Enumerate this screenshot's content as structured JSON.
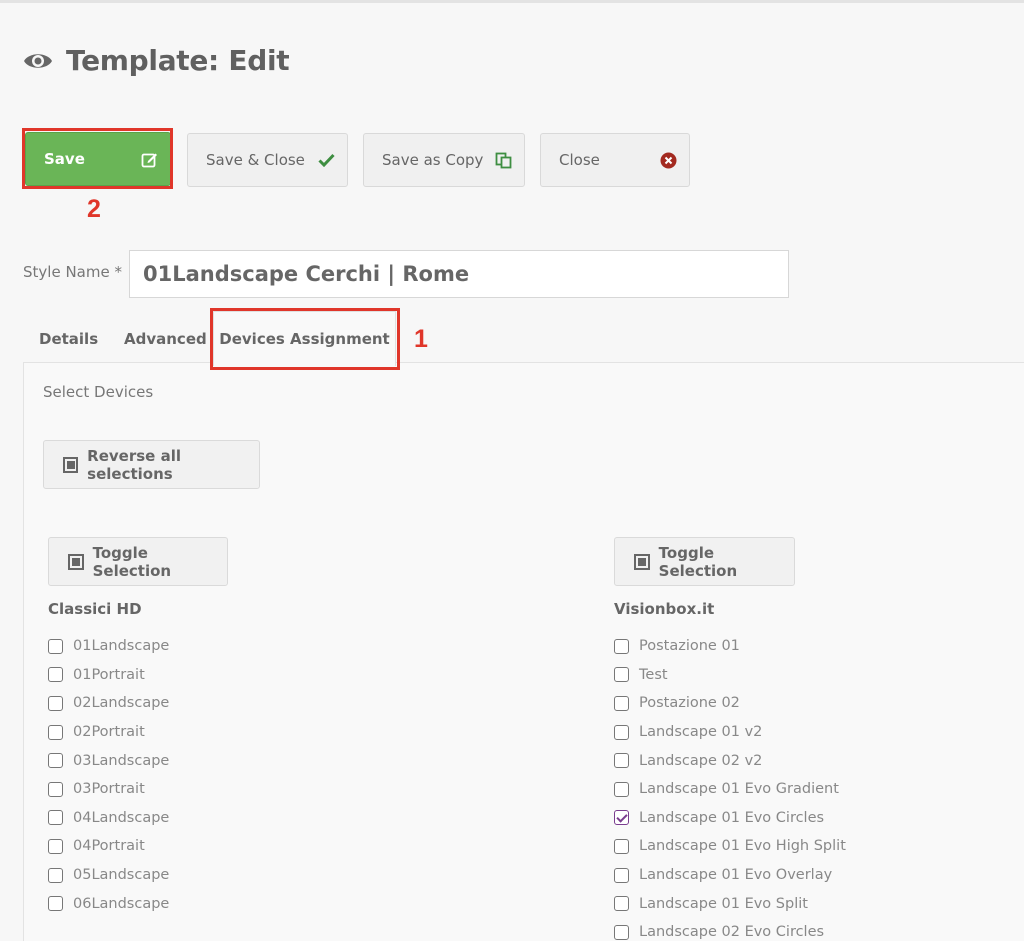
{
  "header": {
    "title": "Template: Edit",
    "icon": "eye-icon"
  },
  "toolbar": {
    "save": {
      "label": "Save",
      "icon": "edit-icon"
    },
    "save_close": {
      "label": "Save & Close",
      "icon": "check-icon"
    },
    "save_copy": {
      "label": "Save as Copy",
      "icon": "copy-icon"
    },
    "close": {
      "label": "Close",
      "icon": "close-circle-icon"
    }
  },
  "annotations": {
    "callout_save": "2",
    "callout_tab": "1",
    "color": "#e0362a"
  },
  "form": {
    "style_name_label": "Style Name *",
    "style_name_value": "01Landscape Cerchi | Rome"
  },
  "tabs": [
    {
      "label": "Details"
    },
    {
      "label": "Advanced"
    },
    {
      "label": "Devices Assignment",
      "active": true
    }
  ],
  "devices": {
    "heading": "Select Devices",
    "reverse_all_label": "Reverse all selections",
    "groups": [
      {
        "name": "Classici HD",
        "toggle_label": "Toggle Selection",
        "items": [
          {
            "label": "01Landscape",
            "checked": false
          },
          {
            "label": "01Portrait",
            "checked": false
          },
          {
            "label": "02Landscape",
            "checked": false
          },
          {
            "label": "02Portrait",
            "checked": false
          },
          {
            "label": "03Landscape",
            "checked": false
          },
          {
            "label": "03Portrait",
            "checked": false
          },
          {
            "label": "04Landscape",
            "checked": false
          },
          {
            "label": "04Portrait",
            "checked": false
          },
          {
            "label": "05Landscape",
            "checked": false
          },
          {
            "label": "06Landscape",
            "checked": false
          }
        ]
      },
      {
        "name": "Visionbox.it",
        "toggle_label": "Toggle Selection",
        "items": [
          {
            "label": "Postazione 01",
            "checked": false
          },
          {
            "label": "Test",
            "checked": false
          },
          {
            "label": "Postazione 02",
            "checked": false
          },
          {
            "label": "Landscape 01 v2",
            "checked": false
          },
          {
            "label": "Landscape 02 v2",
            "checked": false
          },
          {
            "label": "Landscape 01 Evo Gradient",
            "checked": false
          },
          {
            "label": "Landscape 01 Evo Circles",
            "checked": true
          },
          {
            "label": "Landscape 01 Evo High Split",
            "checked": false
          },
          {
            "label": "Landscape 01 Evo Overlay",
            "checked": false
          },
          {
            "label": "Landscape 01 Evo Split",
            "checked": false
          },
          {
            "label": "Landscape 02 Evo Circles",
            "checked": false
          }
        ]
      }
    ]
  },
  "colors": {
    "save_green": "#6ab557",
    "checkbox_checked": "#7a3d8f"
  }
}
